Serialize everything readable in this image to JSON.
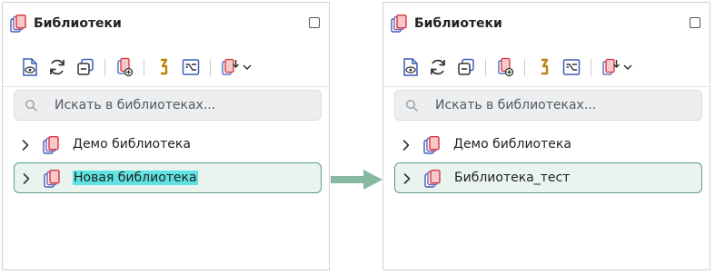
{
  "panels": [
    {
      "title": "Библиотеки",
      "search_placeholder": "Искать в библиотеках...",
      "items": [
        {
          "label": "Демо библиотека",
          "selected": false
        },
        {
          "label": "Новая библиотека",
          "selected": true,
          "text_highlighted": true
        }
      ]
    },
    {
      "title": "Библиотеки",
      "search_placeholder": "Искать в библиотеках...",
      "items": [
        {
          "label": "Демо библиотека",
          "selected": false
        },
        {
          "label": "Библиотека_тест",
          "selected": true,
          "text_highlighted": false
        }
      ]
    }
  ],
  "toolbar_icons": [
    "view-document-icon",
    "refresh-icon",
    "collapse-all-icon",
    "add-library-icon",
    "link-icon",
    "transform-icon",
    "import-library-icon",
    "chevron-down-icon"
  ],
  "colors": {
    "selection_border": "#5a9e84",
    "selection_fill": "#e9f4ee",
    "text_highlight": "#5fe3e2",
    "arrow": "#86b9a0",
    "library_icon_red": "#d7343f",
    "library_icon_blue": "#3f5db8"
  }
}
